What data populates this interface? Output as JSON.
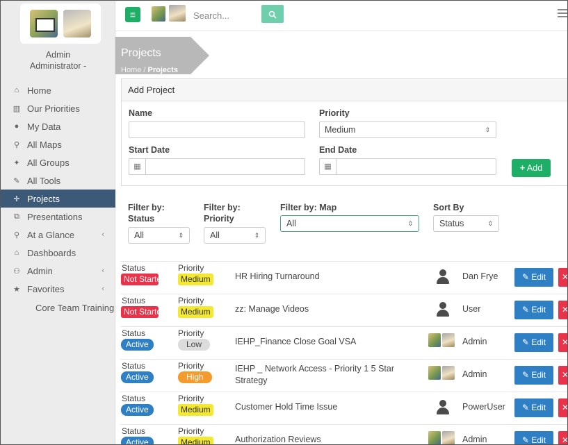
{
  "user": {
    "name": "Admin",
    "role": "Administrator -"
  },
  "sidebar": {
    "items": [
      {
        "label": "Home",
        "icon": "⌂"
      },
      {
        "label": "Our Priorities",
        "icon": "▥"
      },
      {
        "label": "My Data",
        "icon": "●"
      },
      {
        "label": "All Maps",
        "icon": "⚲"
      },
      {
        "label": "All Groups",
        "icon": "✦"
      },
      {
        "label": "All Tools",
        "icon": "✎"
      },
      {
        "label": "Projects",
        "icon": "✛"
      },
      {
        "label": "Presentations",
        "icon": "⧉"
      },
      {
        "label": "At a Glance",
        "icon": "⚲"
      },
      {
        "label": "Dashboards",
        "icon": "⌂"
      },
      {
        "label": "Admin",
        "icon": "⚇"
      },
      {
        "label": "Favorites",
        "icon": "★"
      }
    ],
    "sub_item": "Core Team Training"
  },
  "topbar": {
    "search_placeholder": "Search..."
  },
  "header": {
    "title": "Projects",
    "crumb_home": "Home",
    "crumb_sep": "/",
    "crumb_current": "Projects"
  },
  "add_project": {
    "title": "Add Project",
    "name_label": "Name",
    "name_value": "",
    "priority_label": "Priority",
    "priority_value": "Medium",
    "start_label": "Start Date",
    "end_label": "End Date",
    "add_label": "Add"
  },
  "filters": {
    "status_label_1": "Filter by:",
    "status_label_2": "Status",
    "status_value": "All",
    "priority_label_1": "Filter by:",
    "priority_label_2": "Priority",
    "priority_value": "All",
    "map_label": "Filter by: Map",
    "map_value": "All",
    "sort_label": "Sort By",
    "sort_value": "Status"
  },
  "rows_labels": {
    "status": "Status",
    "priority": "Priority",
    "edit": "Edit"
  },
  "projects": [
    {
      "status": "Not Started",
      "priority": "Medium",
      "name": "HR Hiring Turnaround",
      "owner": "Dan Frye"
    },
    {
      "status": "Not Started",
      "priority": "Medium",
      "name": "zz: Manage Videos",
      "owner": "User"
    },
    {
      "status": "Active",
      "priority": "Low",
      "name": "IEHP_Finance Close Goal VSA",
      "owner": "Admin"
    },
    {
      "status": "Active",
      "priority": "High",
      "name": "IEHP _ Network Access - Priority 1 5 Star Strategy",
      "owner": "Admin"
    },
    {
      "status": "Active",
      "priority": "Medium",
      "name": "Customer Hold Time Issue",
      "owner": "PowerUser"
    },
    {
      "status": "Active",
      "priority": "Medium",
      "name": "Authorization Reviews",
      "owner": "Admin"
    }
  ],
  "colors": {
    "accent_green": "#1fae66",
    "active_nav": "#3c5a78",
    "edit_blue": "#2e7fc4",
    "delete_red": "#e8334a",
    "medium_yellow": "#f3e832",
    "high_orange": "#f49b2e"
  }
}
